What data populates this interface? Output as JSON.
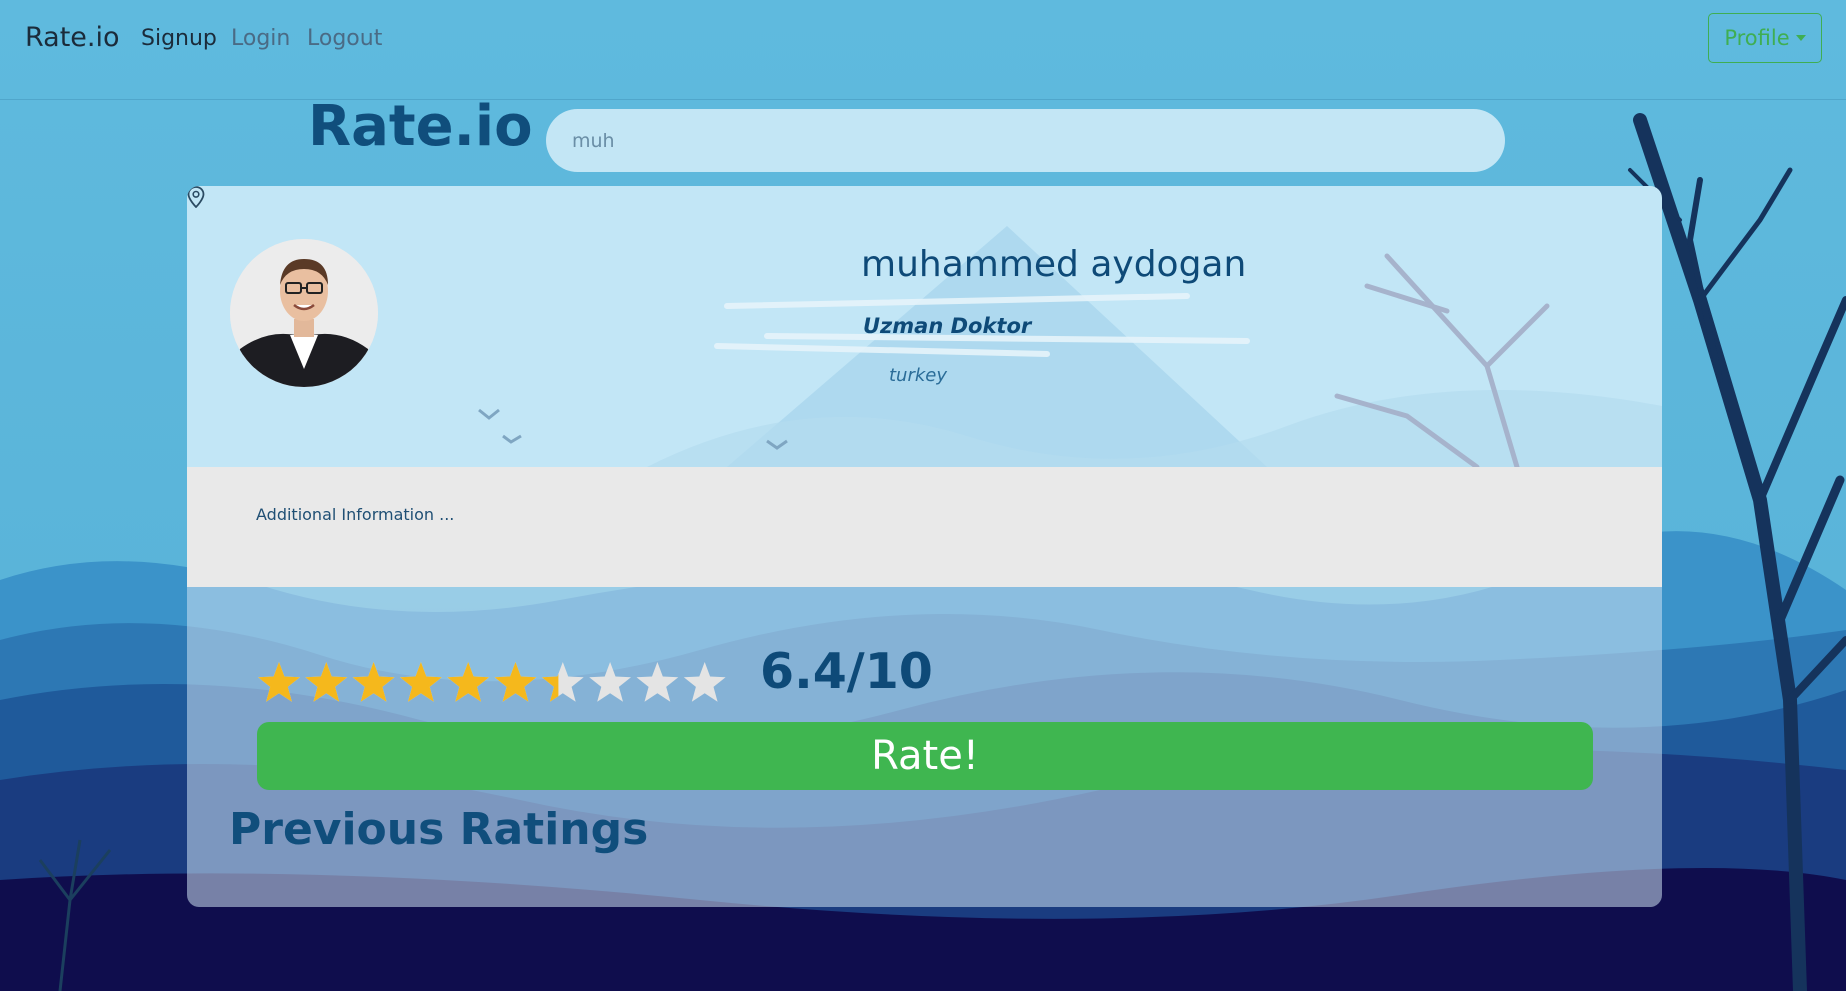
{
  "navbar": {
    "brand": "Rate.io",
    "links": [
      {
        "label": "Signup",
        "active": true
      },
      {
        "label": "Login",
        "active": false
      },
      {
        "label": "Logout",
        "active": false
      }
    ],
    "profile_label": "Profile"
  },
  "header": {
    "title": "Rate.io",
    "search": {
      "value": "muh",
      "placeholder": ""
    }
  },
  "profile": {
    "name": "muhammed aydogan",
    "title": "Uzman Doktor",
    "location": "turkey",
    "additional_info": "Additional Information ..."
  },
  "rating": {
    "score_text": "6.4/10",
    "value": 6.4,
    "max_stars": 10,
    "rate_label": "Rate!"
  },
  "previous": {
    "heading": "Previous Ratings"
  },
  "colors": {
    "accent_green": "#3fb650",
    "title_blue": "#104e7c",
    "star_fill": "#f5b81c",
    "star_empty": "#e4e4e4"
  },
  "icons": {
    "location": "map-pin-icon",
    "dropdown": "chevron-down-icon",
    "star": "star-icon"
  }
}
